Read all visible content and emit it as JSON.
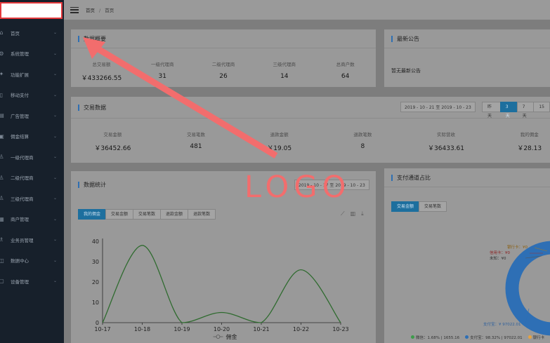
{
  "sidebar": {
    "items": [
      {
        "label": "首页",
        "icon": "home-icon",
        "glyph": "⌂"
      },
      {
        "label": "系统管理",
        "icon": "gear-icon",
        "glyph": "⚙"
      },
      {
        "label": "功能扩展",
        "icon": "puzzle-icon",
        "glyph": "✦"
      },
      {
        "label": "移动支付",
        "icon": "phone-icon",
        "glyph": "▯"
      },
      {
        "label": "广告管理",
        "icon": "ad-icon",
        "glyph": "▤"
      },
      {
        "label": "佣金结算",
        "icon": "wallet-icon",
        "glyph": "▣"
      },
      {
        "label": "一级代理商",
        "icon": "user-icon",
        "glyph": "♙"
      },
      {
        "label": "二级代理商",
        "icon": "user-icon",
        "glyph": "♙"
      },
      {
        "label": "三级代理商",
        "icon": "user-icon",
        "glyph": "♙"
      },
      {
        "label": "商户管理",
        "icon": "store-icon",
        "glyph": "▦"
      },
      {
        "label": "业务员管理",
        "icon": "users-icon",
        "glyph": "♗"
      },
      {
        "label": "数据中心",
        "icon": "database-icon",
        "glyph": "◫"
      },
      {
        "label": "设备管理",
        "icon": "device-icon",
        "glyph": "▢"
      }
    ]
  },
  "topbar": {
    "breadcrumb_root": "首页",
    "breadcrumb_sep": "/",
    "breadcrumb_current": "首页"
  },
  "overview": {
    "title": "数据概要",
    "stats": [
      {
        "label": "总交易额",
        "value": "￥433266.55"
      },
      {
        "label": "一级代理商",
        "value": "31"
      },
      {
        "label": "二级代理商",
        "value": "26"
      },
      {
        "label": "三级代理商",
        "value": "14"
      },
      {
        "label": "总商户数",
        "value": "64"
      }
    ]
  },
  "notice": {
    "title": "最新公告",
    "text": "暂无最新公告"
  },
  "trade": {
    "title": "交易数据",
    "daterange": "2019 - 10 - 21 至 2019 - 10 - 23",
    "ranges": [
      "昨天",
      "3天",
      "7天",
      "15"
    ],
    "active_range": 1,
    "stats": [
      {
        "label": "交易金额",
        "value": "￥36452.66"
      },
      {
        "label": "交易笔数",
        "value": "481"
      },
      {
        "label": "退款金额",
        "value": "￥19.05"
      },
      {
        "label": "退款笔数",
        "value": "8"
      },
      {
        "label": "实际营收",
        "value": "￥36433.61"
      },
      {
        "label": "我的佣金",
        "value": "￥28.13"
      }
    ]
  },
  "stats_chart": {
    "title": "数据统计",
    "daterange": "2019 - 10 - 17 至 2019 - 10 - 23",
    "tabs": [
      "我的佣金",
      "交易金额",
      "交易笔数",
      "退款金额",
      "退款笔数"
    ],
    "active_tab": 0,
    "tools": [
      "line-chart-icon",
      "bar-chart-icon",
      "download-icon"
    ]
  },
  "pay_channel": {
    "title": "支付通道占比",
    "tabs": [
      "交易金额",
      "交易笔数"
    ],
    "active_tab": 0,
    "labels": {
      "bank": "银行卡：¥0",
      "credit": "信用卡：¥0",
      "unknown": "未知：¥0",
      "alipay": "支付宝：¥ 97022.01"
    },
    "legend": [
      {
        "label": "微信：1.68% | 1655.16",
        "color": "#3c9c4a"
      },
      {
        "label": "支付宝：98.32% | 97022.01",
        "color": "#2e6fb5"
      },
      {
        "label": "银行卡",
        "color": "#e8a33d"
      }
    ]
  },
  "annotation": {
    "text": "LOGO",
    "color": "#f26d6d"
  },
  "chart_data": {
    "type": "line",
    "x": [
      "10-17",
      "10-18",
      "10-19",
      "10-20",
      "10-21",
      "10-22",
      "10-23"
    ],
    "series": [
      {
        "name": "佣金",
        "values": [
          0,
          38,
          0,
          5,
          0,
          26,
          0
        ],
        "color": "#2f6b2f"
      }
    ],
    "ylim": [
      0,
      40
    ],
    "yticks": [
      0,
      10,
      20,
      30,
      40
    ],
    "legend_position": "bottom"
  }
}
